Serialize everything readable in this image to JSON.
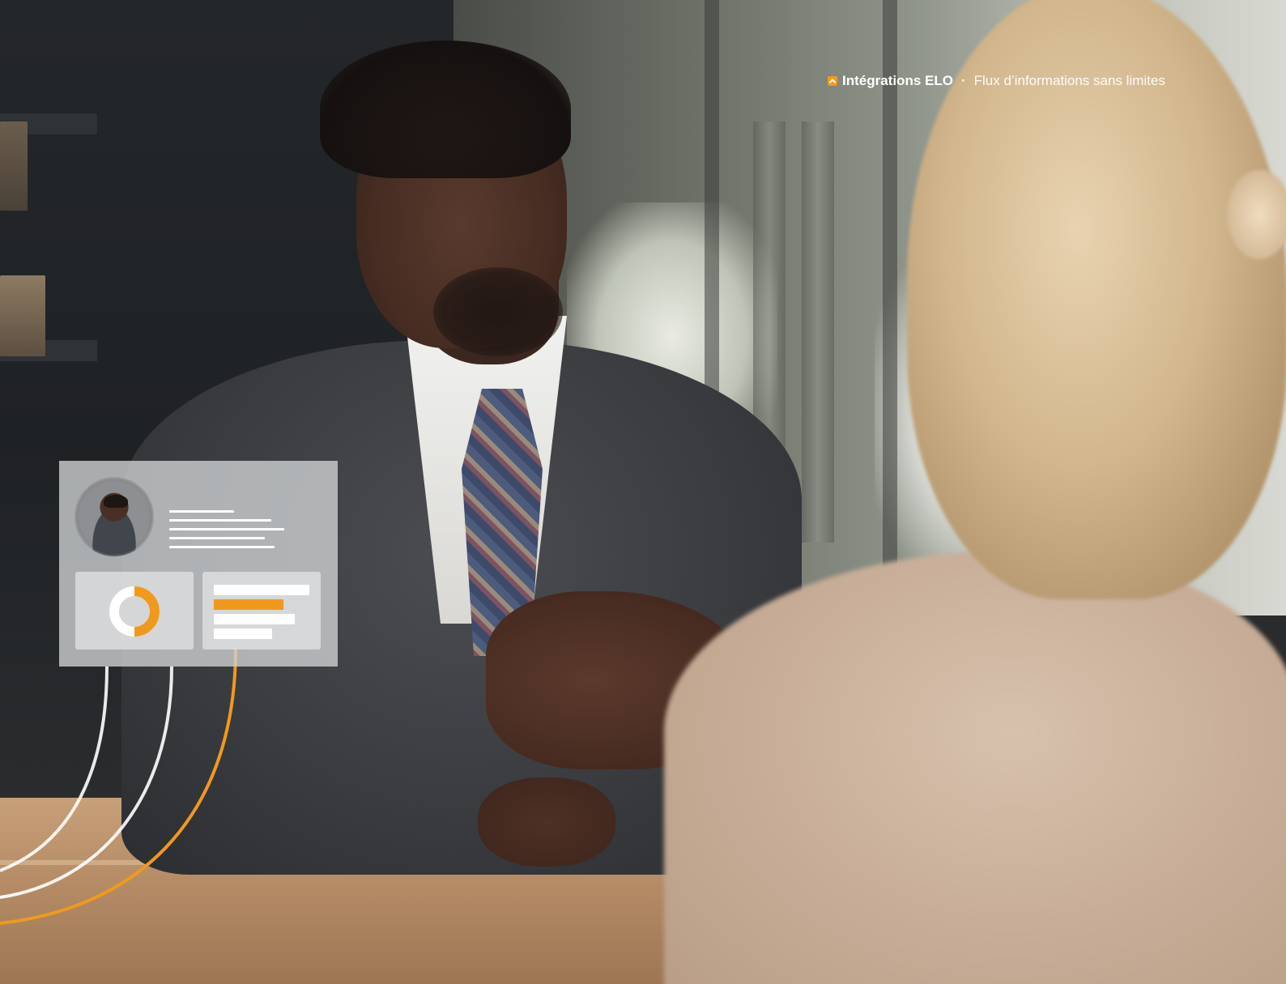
{
  "header": {
    "brand": "Intégrations ELO",
    "separator": "·",
    "tagline": "Flux d’informations sans limites",
    "logo_icon": "elo-logo-icon",
    "accent_color": "#ef9a1d"
  },
  "card": {
    "avatar_icon": "user-avatar-icon",
    "donut_progress": 0.5,
    "chart_colors": {
      "accent": "#ef9a1d",
      "neutral": "#ffffff"
    }
  },
  "colors": {
    "accent": "#ef9a1d",
    "arc_light": "#ffffff"
  }
}
